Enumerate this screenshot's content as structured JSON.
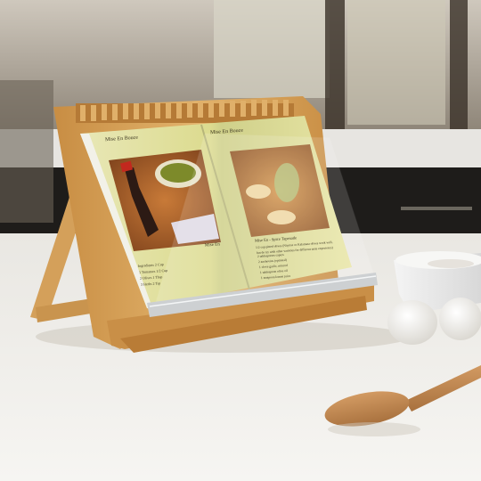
{
  "scene": {
    "description_visible": false
  },
  "cookbook": {
    "left_page": {
      "header": "Mise En Bouce",
      "photo_caption": "Mise En",
      "table_lines": [
        "Ingredients 2 Cup",
        "1 Tomatoes   1/2 Cup",
        "2 Olives   1 Tbsp",
        "3 Herbs    2 Tsp"
      ]
    },
    "right_page": {
      "header": "Mise En  Bouce",
      "recipe_title": "Mise En - Spice Tapenade",
      "recipe_lines": [
        "1/2 cup pitted olives (Niçoise or Kalamata olives work well,",
        "but do try with other varieties for different taste experience)",
        "2 tablespoons capers",
        "2 anchovies (optional)",
        "1 clove garlic, minced",
        "1 tablespoon olive oil",
        "1 teaspoon lemon juice"
      ]
    }
  },
  "colors": {
    "counter": "#f1efea",
    "bamboo": "#d9a65c",
    "bamboo_dark": "#b98038",
    "page": "#e6e3a0",
    "acrylic_bar": "#c9ccce"
  }
}
